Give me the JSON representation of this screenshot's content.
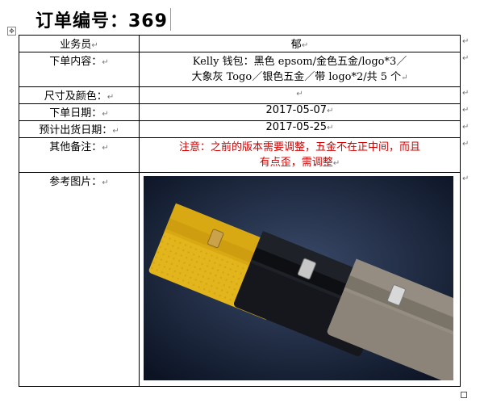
{
  "document": {
    "title": "订单编号：369",
    "rows": [
      {
        "label": "业务员",
        "value": "郁"
      },
      {
        "label": "下单内容：",
        "value_line1": "Kelly 钱包：黑色 epsom/金色五金/logo*3／",
        "value_line2": "大象灰 Togo／银色五金／带 logo*2/共 5 个"
      },
      {
        "label": "尺寸及颜色：",
        "value": ""
      },
      {
        "label": "下单日期：",
        "value": "2017-05-07"
      },
      {
        "label": "预计出货日期：",
        "value": "2017-05-25"
      },
      {
        "label": "其他备注：",
        "value_line1": "注意：之前的版本需要调整，五金不在正中间，而且",
        "value_line2": "有点歪，需调整"
      },
      {
        "label": "参考图片："
      }
    ],
    "marks": {
      "paragraph": "↵",
      "move": "✥"
    }
  },
  "photo": {
    "background_color": "#1d2a44",
    "wallets": [
      {
        "color_name": "yellow",
        "color": "#e2b51c"
      },
      {
        "color_name": "black",
        "color": "#15171c"
      },
      {
        "color_name": "elephant-grey",
        "color": "#8c8478"
      }
    ]
  }
}
